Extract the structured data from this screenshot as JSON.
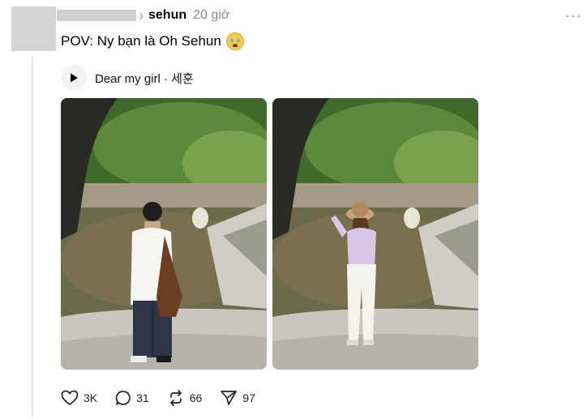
{
  "post": {
    "author": "sehun",
    "time": "20 giờ",
    "text": "POV: Ny bạn là Oh Sehun",
    "emoji": "crying-face-emoji"
  },
  "music": {
    "label": "Dear my girl · 세훈"
  },
  "images": [
    {
      "subject": "man-standing-by-stream"
    },
    {
      "subject": "woman-with-hat-by-stream"
    }
  ],
  "actions": {
    "likes": "3K",
    "comments": "31",
    "reposts": "66",
    "shares": "97"
  },
  "colors": {
    "muted_text": "#8a8a8a",
    "divider": "#e5e5e5"
  }
}
